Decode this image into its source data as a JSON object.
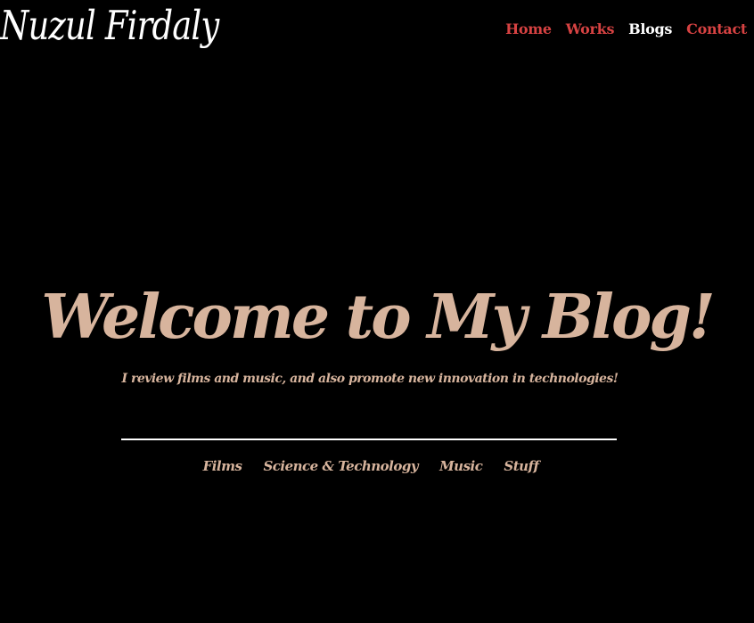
{
  "header": {
    "logo_text": "Nuzul Firdaly",
    "nav": [
      {
        "label": "Home",
        "active": false
      },
      {
        "label": "Works",
        "active": false
      },
      {
        "label": "Blogs",
        "active": true
      },
      {
        "label": "Contact",
        "active": false
      }
    ]
  },
  "hero": {
    "title": "Welcome to My Blog!",
    "subtitle": "I review films and music, and also promote new innovation in technologies!"
  },
  "categories": [
    {
      "label": "Films"
    },
    {
      "label": "Science & Technology"
    },
    {
      "label": "Music"
    },
    {
      "label": "Stuff"
    }
  ],
  "colors": {
    "background": "#000000",
    "nav_link": "#d64242",
    "nav_active": "#ffffff",
    "accent_tan": "#d7b49d",
    "divider": "#ffffff"
  }
}
